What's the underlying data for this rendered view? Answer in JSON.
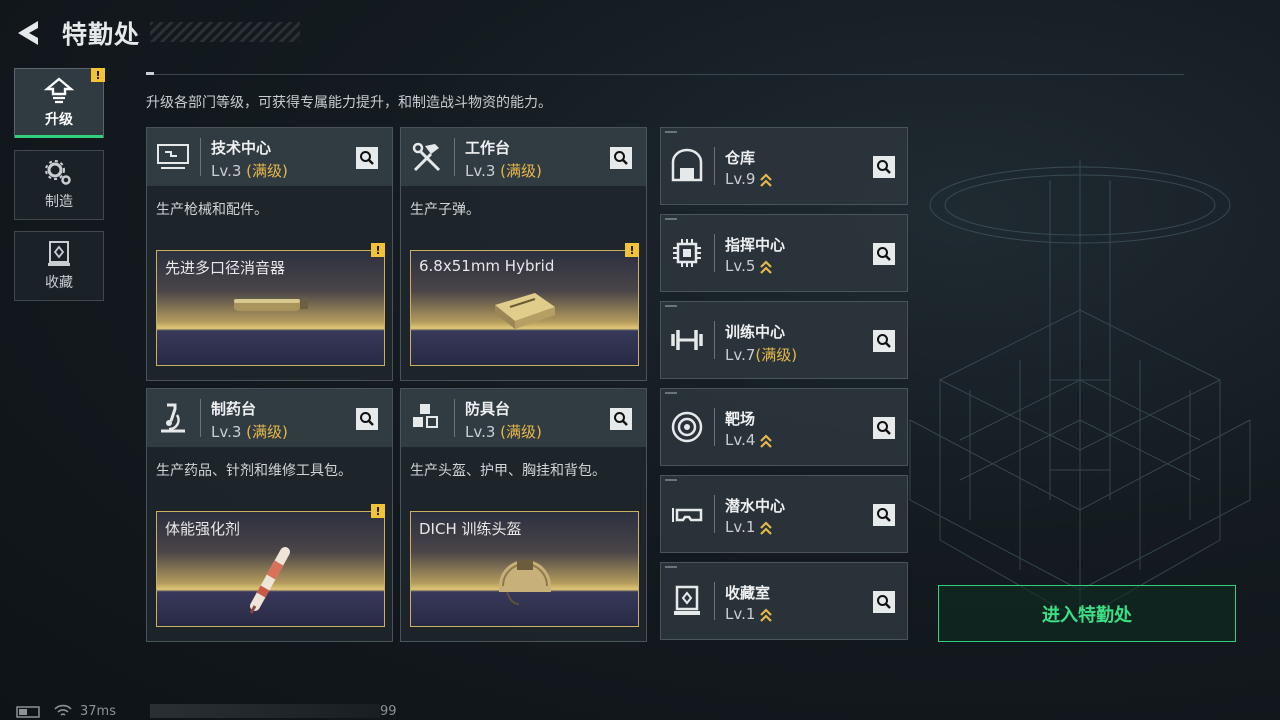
{
  "header": {
    "title": "特勤处"
  },
  "description": "升级各部门等级，可获得专属能力提升，和制造战斗物资的能力。",
  "tabs": [
    {
      "label": "升级",
      "icon": "upgrade-icon",
      "active": true,
      "warning": "!"
    },
    {
      "label": "制造",
      "icon": "gears-icon",
      "active": false
    },
    {
      "label": "收藏",
      "icon": "collection-icon",
      "active": false
    }
  ],
  "cards": [
    {
      "name": "技术中心",
      "level": "Lv.3",
      "max_tag": "(满级)",
      "desc": "生产枪械和配件。",
      "item": "先进多口径消音器",
      "warning": "!"
    },
    {
      "name": "工作台",
      "level": "Lv.3",
      "max_tag": "(满级)",
      "desc": "生产子弹。",
      "item": "6.8x51mm Hybrid",
      "warning": "!"
    },
    {
      "name": "制药台",
      "level": "Lv.3",
      "max_tag": "(满级)",
      "desc": "生产药品、针剂和维修工具包。",
      "item": "体能强化剂",
      "warning": "!"
    },
    {
      "name": "防具台",
      "level": "Lv.3",
      "max_tag": "(满级)",
      "desc": "生产头盔、护甲、胸挂和背包。",
      "item": "DICH 训练头盔"
    }
  ],
  "facilities": [
    {
      "name": "仓库",
      "level": "Lv.9",
      "icon": "warehouse-icon"
    },
    {
      "name": "指挥中心",
      "level": "Lv.5",
      "icon": "chip-icon"
    },
    {
      "name": "训练中心",
      "level": "Lv.7",
      "max_tag": "(满级)",
      "icon": "dumbbell-icon"
    },
    {
      "name": "靶场",
      "level": "Lv.4",
      "icon": "target-icon"
    },
    {
      "name": "潜水中心",
      "level": "Lv.1",
      "icon": "goggles-icon"
    },
    {
      "name": "收藏室",
      "level": "Lv.1",
      "icon": "display-case-icon"
    }
  ],
  "enter_button": "进入特勤处",
  "footer": {
    "ping": "37ms",
    "fps": "99"
  },
  "colors": {
    "accent_green": "#2fd27b",
    "max_gold": "#e6b84a",
    "warning_yellow": "#f2c335"
  }
}
